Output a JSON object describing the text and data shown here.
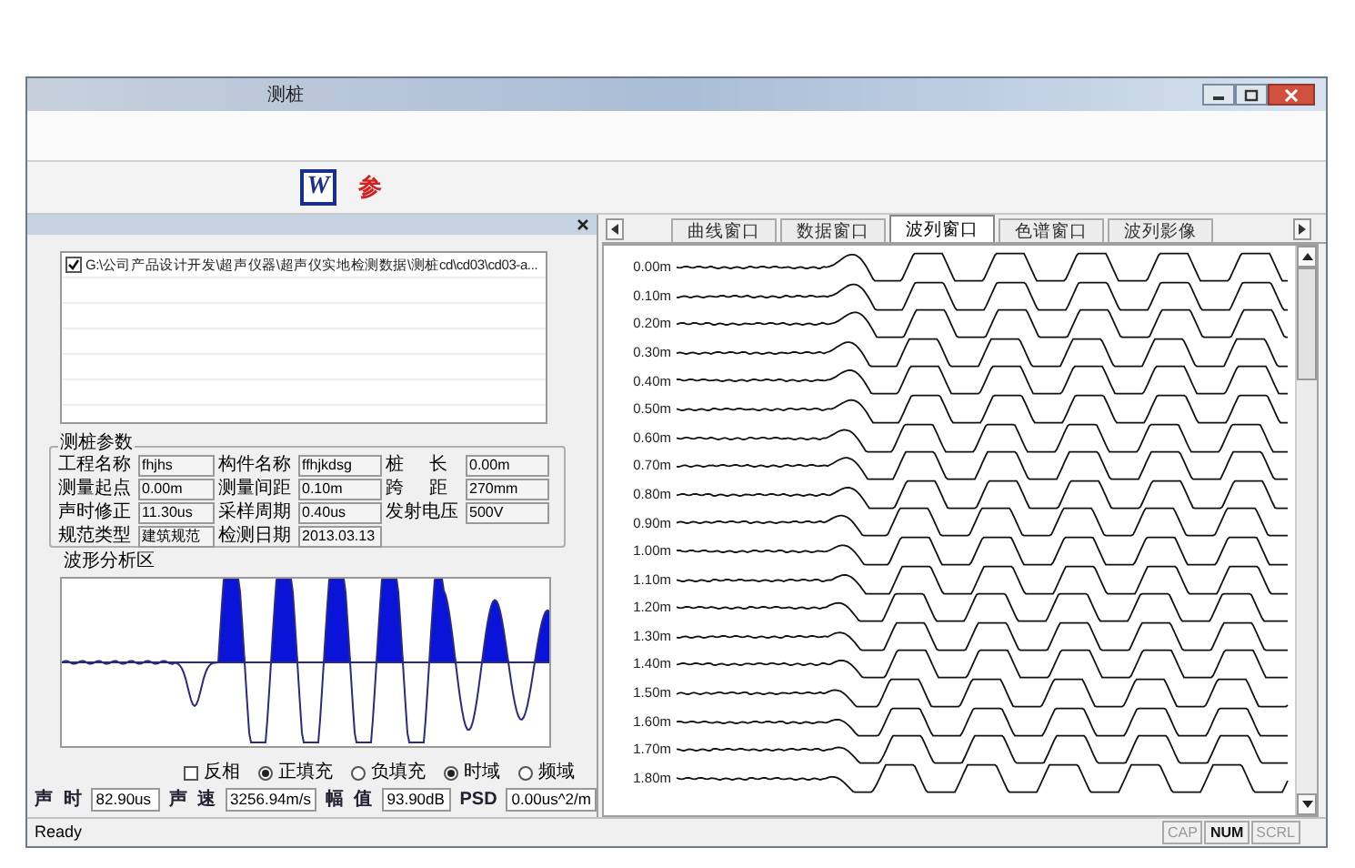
{
  "window": {
    "title": "测桩"
  },
  "toolbar": {
    "buttons": [
      {
        "kind": "word",
        "label": "W"
      },
      {
        "kind": "text",
        "label": "参"
      }
    ]
  },
  "left_panel": {
    "files": [
      {
        "path": "G:\\公司产品设计开发\\超声仪器\\超声仪实地检测数据\\测桩cd\\cd03\\cd03-a...",
        "checked": true
      }
    ],
    "params": {
      "title": "测桩参数",
      "fields": [
        {
          "label": "工程名称",
          "value": "fhjhs"
        },
        {
          "label": "构件名称",
          "value": "ffhjkdsg"
        },
        {
          "label": "桩 长",
          "value": "0.00m"
        },
        {
          "label": "测量起点",
          "value": "0.00m"
        },
        {
          "label": "测量间距",
          "value": "0.10m"
        },
        {
          "label": "跨 距",
          "value": "270mm"
        },
        {
          "label": "声时修正",
          "value": "11.30us"
        },
        {
          "label": "采样周期",
          "value": "0.40us"
        },
        {
          "label": "发射电压",
          "value": "500V"
        },
        {
          "label": "规范类型",
          "value": "建筑规范"
        },
        {
          "label": "检测日期",
          "value": "2013.03.13"
        }
      ]
    },
    "wave_area": {
      "title": "波形分析区"
    },
    "options": [
      {
        "kind": "checkbox",
        "label": "反相",
        "checked": false
      },
      {
        "kind": "radio",
        "label": "正填充",
        "selected": true
      },
      {
        "kind": "radio",
        "label": "负填充",
        "selected": false
      },
      {
        "kind": "radio",
        "label": "时域",
        "selected": true
      },
      {
        "kind": "radio",
        "label": "频域",
        "selected": false
      }
    ],
    "readouts": [
      {
        "label": "声 时",
        "value": "82.90us"
      },
      {
        "label": "声 速",
        "value": "3256.94m/s"
      },
      {
        "label": "幅 值",
        "value": "93.90dB"
      },
      {
        "label": "PSD",
        "value": "0.00us^2/m"
      }
    ]
  },
  "right_panel": {
    "tabs": [
      {
        "label": "曲线窗口",
        "selected": false
      },
      {
        "label": "数据窗口",
        "selected": false
      },
      {
        "label": "波列窗口",
        "selected": true
      },
      {
        "label": "色谱窗口",
        "selected": false
      },
      {
        "label": "波列影像",
        "selected": false
      }
    ],
    "rows": [
      "0.00m",
      "0.10m",
      "0.20m",
      "0.30m",
      "0.40m",
      "0.50m",
      "0.60m",
      "0.70m",
      "0.80m",
      "0.90m",
      "1.00m",
      "1.10m",
      "1.20m",
      "1.30m",
      "1.40m",
      "1.50m",
      "1.60m",
      "1.70m",
      "1.80m"
    ]
  },
  "status_bar": {
    "text": "Ready",
    "indicators": [
      {
        "label": "CAP",
        "on": false
      },
      {
        "label": "NUM",
        "on": true
      },
      {
        "label": "SCRL",
        "on": false
      }
    ]
  }
}
